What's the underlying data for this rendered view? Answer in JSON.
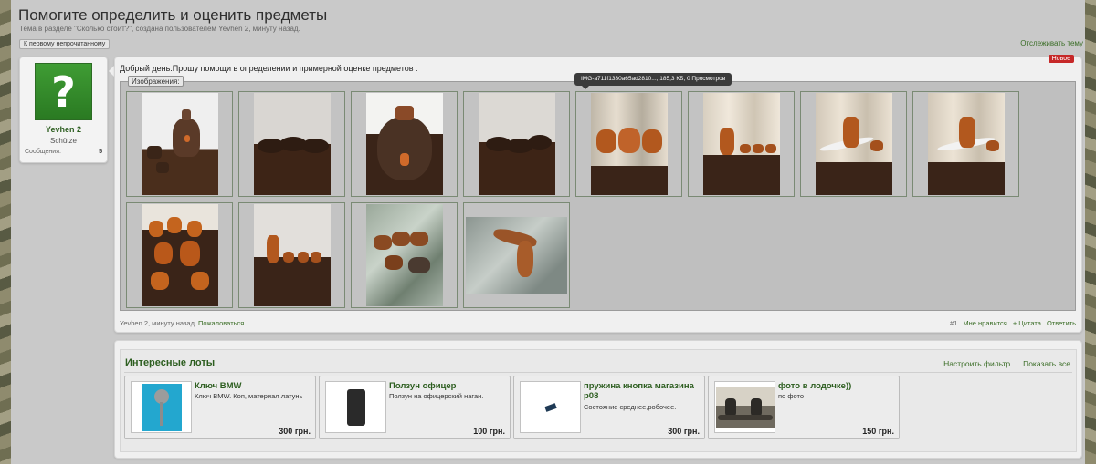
{
  "page": {
    "title": "Помогите определить и оценить предметы",
    "description": "Тема в разделе \"Сколько стоит?\", создана пользователем Yevhen 2, минуту назад.",
    "first_unread": "К первому непрочитанному",
    "watch_thread": "Отслеживать тему"
  },
  "user": {
    "name": "Yevhen 2",
    "title": "Schütze",
    "messages_label": "Сообщения:",
    "messages_count": "5"
  },
  "post": {
    "new_badge": "Новое",
    "text": "Добрый день.Прошу помощи в определении и примерной оценке предметов .",
    "attachments_label": "Изображения:",
    "tooltip": "IMG-a711f1330a65ad2810..., 185,3 КБ, 0 Просмотров",
    "footer_author": "Yevhen 2, минуту назад",
    "footer_report": "Пожаловаться",
    "footer_number": "#1",
    "footer_like": "Мне нравится",
    "footer_quote": "+ Цитата",
    "footer_reply": "Ответить"
  },
  "lots": {
    "title": "Интересные лоты",
    "filter_label": "Настроить фильтр",
    "show_all_label": "Показать все",
    "items": [
      {
        "name": "Ключ BMW",
        "desc": "Ключ BMW. Коп, материал латунь",
        "price": "300 грн."
      },
      {
        "name": "Ползун офицер",
        "desc": "Ползун на офицерский наган.",
        "price": "100 грн."
      },
      {
        "name": "пружина кнопка магазина р08",
        "desc": "Состояние среднее,робочее.",
        "price": "300 грн."
      },
      {
        "name": "фото в лодочке))",
        "desc": "по фото",
        "price": "150 грн."
      }
    ]
  },
  "colors": {
    "accent_green": "#2d5e20",
    "link_green": "#3a6d26",
    "badge_red": "#c62828",
    "avatar_green": "#3f9c34"
  }
}
